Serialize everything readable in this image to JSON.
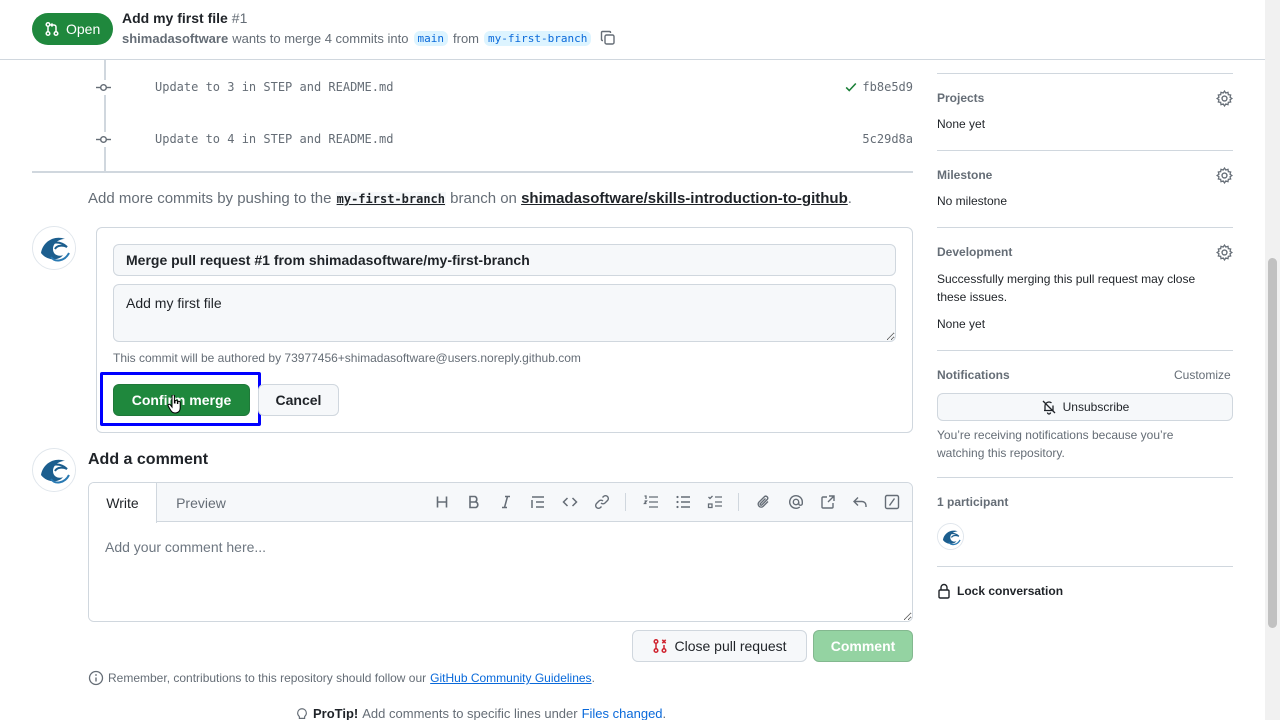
{
  "header": {
    "state": "Open",
    "title": "Add my first file",
    "number": "#1",
    "author": "shimadasoftware",
    "merge_text": "wants to merge 4 commits into",
    "base_branch": "main",
    "from_text": "from",
    "head_branch": "my-first-branch"
  },
  "commits": [
    {
      "message": "Update to 3 in STEP and README.md",
      "sha": "fb8e5d9",
      "status": "success"
    },
    {
      "message": "Update to 4 in STEP and README.md",
      "sha": "5c29d8a",
      "status": "none"
    }
  ],
  "push_hint": {
    "prefix": "Add more commits by pushing to the",
    "branch": "my-first-branch",
    "middle": "branch on",
    "repo": "shimadasoftware/skills-introduction-to-github",
    "suffix": "."
  },
  "merge_box": {
    "title_value": "Merge pull request #1 from shimadasoftware/my-first-branch",
    "body_value": "Add my first file",
    "author_note": "This commit will be authored by 73977456+shimadasoftware@users.noreply.github.com",
    "confirm_label": "Confirm merge",
    "cancel_label": "Cancel"
  },
  "comment": {
    "heading": "Add a comment",
    "tab_write": "Write",
    "tab_preview": "Preview",
    "placeholder": "Add your comment here...",
    "close_label": "Close pull request",
    "comment_label": "Comment",
    "toolbar_icons": [
      "heading-icon",
      "bold-icon",
      "italic-icon",
      "quote-icon",
      "code-icon",
      "link-icon",
      "ordered-list-icon",
      "unordered-list-icon",
      "task-list-icon",
      "attach-icon",
      "mention-icon",
      "reference-icon",
      "reply-icon",
      "slash-command-icon"
    ]
  },
  "footer": {
    "guidelines_prefix": "Remember, contributions to this repository should follow our",
    "guidelines_link": "GitHub Community Guidelines",
    "guidelines_suffix": ".",
    "protip_bold": "ProTip!",
    "protip_text": "Add comments to specific lines under",
    "protip_link": "Files changed",
    "protip_suffix": "."
  },
  "sidebar": {
    "projects_heading": "Projects",
    "projects_value": "None yet",
    "milestone_heading": "Milestone",
    "milestone_value": "No milestone",
    "development_heading": "Development",
    "development_text": "Successfully merging this pull request may close these issues.",
    "development_value": "None yet",
    "notifications_heading": "Notifications",
    "customize_label": "Customize",
    "unsubscribe_label": "Unsubscribe",
    "notifications_reason": "You’re receiving notifications because you’re watching this repository.",
    "participants_heading": "1 participant",
    "lock_label": "Lock conversation"
  },
  "colors": {
    "success": "#1f883d",
    "accent": "#0969da",
    "highlight": "#0000ff"
  }
}
